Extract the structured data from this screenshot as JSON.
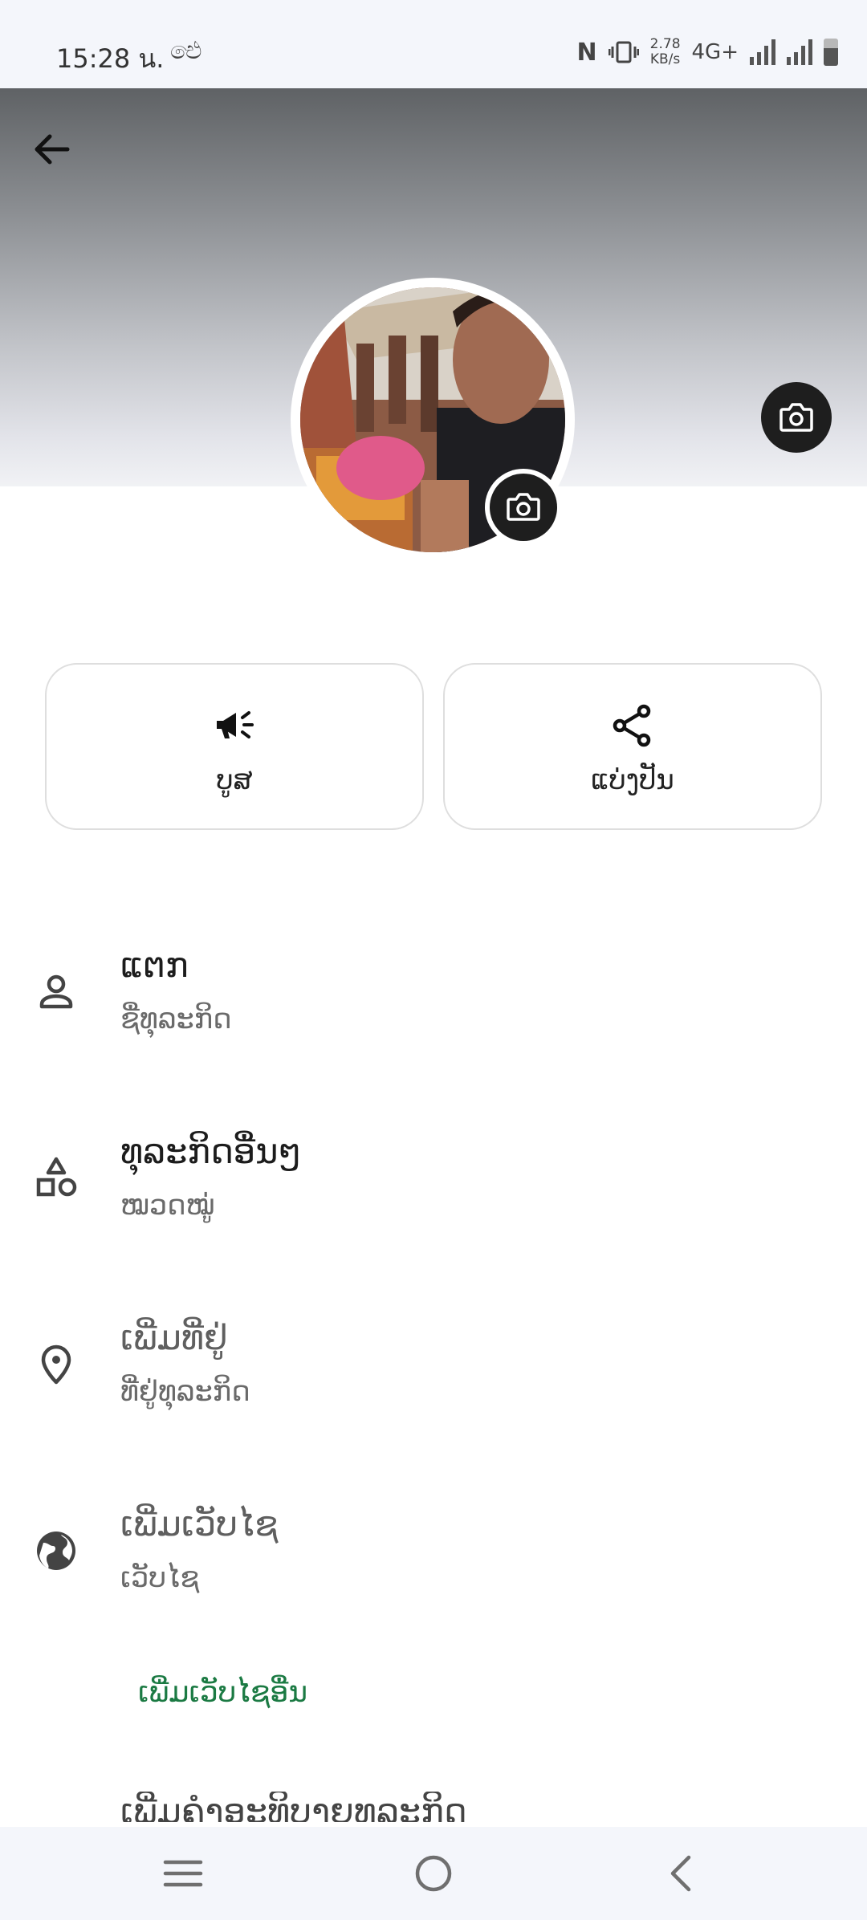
{
  "status_bar": {
    "time": "15:28 น.",
    "sync_symbol": "ඓ",
    "nfc": "N",
    "speed_value": "2.78",
    "speed_unit": "KB/s",
    "network": "4G+",
    "battery_level": 0.65
  },
  "header": {
    "back_icon": "arrow-left-icon",
    "cover_camera_icon": "camera-icon",
    "avatar_camera_icon": "camera-icon"
  },
  "actions": [
    {
      "label": "ບູສ",
      "icon": "megaphone-icon"
    },
    {
      "label": "ແບ່ງປັນ",
      "icon": "share-icon"
    }
  ],
  "fields": [
    {
      "title": "ແຕກ",
      "subtitle": "ຊື່ທຸລະກິດ",
      "icon": "person-icon"
    },
    {
      "title": "ທຸລະກິດອື່ນໆ",
      "subtitle": "ໝວດໝູ່",
      "icon": "shapes-icon"
    },
    {
      "title": "ເພີ່ມທີ່ຢູ່",
      "subtitle": "ທີ່ຢູ່ທຸລະກິດ",
      "icon": "location-pin-icon"
    },
    {
      "title": "ເພີ່ມເວັບໄຊ",
      "subtitle": "ເວັບໄຊ",
      "icon": "globe-icon"
    }
  ],
  "add_website_link": "ເພີ່ມເວັບໄຊອື່ນ",
  "partial_row_text": "ເພີ່ມຄຳອະທິບາຍທຸລະກິດ",
  "nav_bar": {
    "icons": [
      "menu-icon",
      "home-circle-icon",
      "back-chevron-icon"
    ]
  },
  "colors": {
    "accent_green": "#1b7a43",
    "dark_button": "#1e1e1e",
    "bar_background": "#f4f6fb"
  }
}
